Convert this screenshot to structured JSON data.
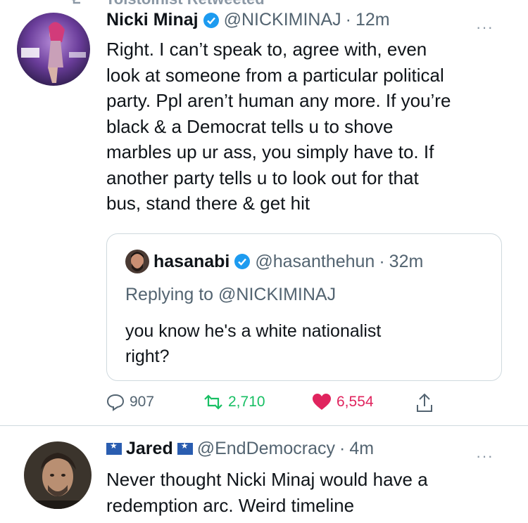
{
  "retweet_strip": {
    "text": "Tolstoinist Retweeted"
  },
  "tweet1": {
    "name": "Nicki Minaj",
    "handle": "@NICKIMINAJ",
    "separator": "·",
    "time": "12m",
    "more": "···",
    "text_lines": [
      "Right. I can’t speak to, agree with, even",
      "look at someone from a particular political",
      "party. Ppl aren’t human any more. If you’re",
      "black & a Democrat tells u to shove",
      "marbles up ur ass, you simply have to. If",
      "another party tells u to look out for that",
      "bus, stand there & get hit"
    ],
    "quote": {
      "name": "hasanabi",
      "handle": "@hasanthehun",
      "separator": "·",
      "time": "32m",
      "replying_prefix": "Replying to",
      "replying_handle": "@NICKIMINAJ",
      "text_lines": [
        "you know he's a white nationalist",
        "right?"
      ]
    },
    "actions": {
      "replies": "907",
      "retweets": "2,710",
      "likes": "6,554"
    },
    "colors": {
      "like": "#e0245e",
      "retweet": "#17bf63",
      "verified": "#1d9bf0"
    }
  },
  "tweet2": {
    "name": "Jared",
    "handle": "@EndDemocracy",
    "separator": "·",
    "time": "4m",
    "more": "···",
    "text_lines": [
      "Never thought Nicki Minaj would have a",
      "redemption arc. Weird timeline"
    ]
  }
}
